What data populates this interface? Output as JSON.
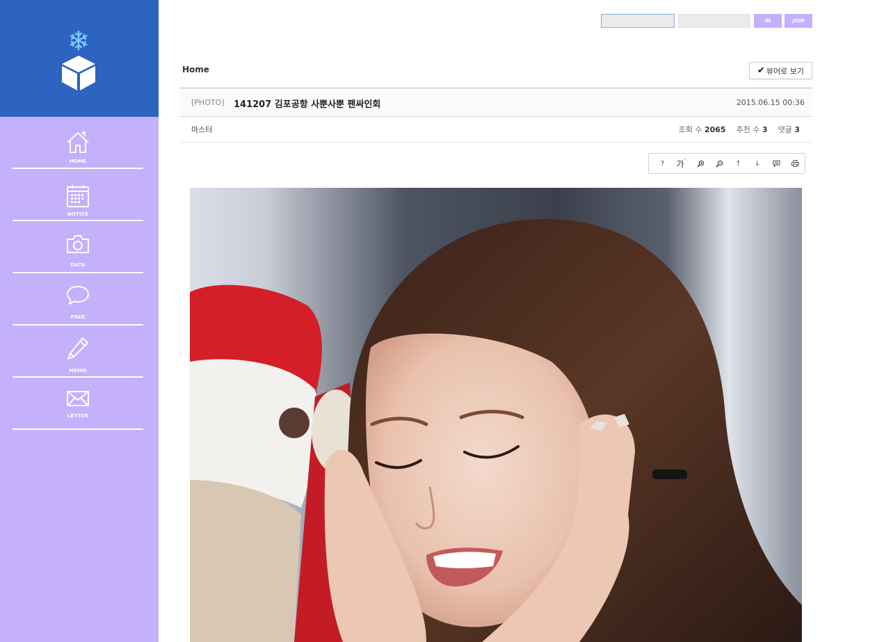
{
  "sidebar": {
    "items": [
      {
        "label": "HOME"
      },
      {
        "label": "NOTICE"
      },
      {
        "label": "DATA"
      },
      {
        "label": "FREE"
      },
      {
        "label": "MEMO"
      },
      {
        "label": "LETTER"
      }
    ]
  },
  "login": {
    "in_label": "IN",
    "join_label": "JOIN",
    "id_value": "",
    "pw_value": ""
  },
  "breadcrumb": "Home",
  "viewer_button": "뷰어로 보기",
  "post": {
    "category": "[PHOTO]",
    "title": "141207 김포공항 사뿐사뿐 팬싸인회",
    "date": "2015.06.15 00:36",
    "author": "마스터",
    "views_label": "조회 수",
    "views": "2065",
    "recommend_label": "추천 수",
    "recommend": "3",
    "comments_label": "댓글",
    "comments": "3"
  },
  "toolbar": {
    "help": "?",
    "font": "가",
    "zoom_in": "zoom-in-icon",
    "zoom_out": "zoom-out-icon",
    "up": "↑",
    "down": "↓",
    "comment": "comment-icon",
    "print": "print-icon"
  },
  "colors": {
    "sidebar": "#c4b0fb",
    "logo_bg": "#2d63c1",
    "button": "#c4b0fb"
  }
}
